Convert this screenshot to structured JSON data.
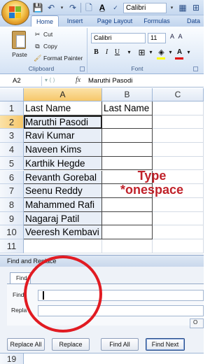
{
  "qat": {
    "font_value": "Calibri"
  },
  "tabs": [
    "Home",
    "Insert",
    "Page Layout",
    "Formulas",
    "Data"
  ],
  "clipboard": {
    "paste": "Paste",
    "cut": "Cut",
    "copy": "Copy",
    "format_painter": "Format Painter",
    "group_label": "Clipboard"
  },
  "font_group": {
    "font_name": "Calibri",
    "font_size": "11",
    "group_label": "Font",
    "bold": "B",
    "italic": "I",
    "underline": "U"
  },
  "formula_bar": {
    "name_box": "A2",
    "fx": "fx",
    "value": "Maruthi Pasodi"
  },
  "sheet": {
    "columns": [
      "A",
      "B",
      "C"
    ],
    "rows": [
      {
        "n": "1",
        "a": "Last Name",
        "b": "Last Name"
      },
      {
        "n": "2",
        "a": "Maruthi Pasodi",
        "b": ""
      },
      {
        "n": "3",
        "a": "Ravi Kumar",
        "b": ""
      },
      {
        "n": "4",
        "a": "Naveen Kims",
        "b": ""
      },
      {
        "n": "5",
        "a": "Karthik Hegde",
        "b": ""
      },
      {
        "n": "6",
        "a": "Revanth Gorebal",
        "b": ""
      },
      {
        "n": "7",
        "a": "Seenu Reddy",
        "b": ""
      },
      {
        "n": "8",
        "a": "Mahammed Rafi",
        "b": ""
      },
      {
        "n": "9",
        "a": "Nagaraj Patil",
        "b": ""
      },
      {
        "n": "10",
        "a": "Veeresh Kembavi",
        "b": ""
      },
      {
        "n": "11",
        "a": "",
        "b": ""
      }
    ],
    "bottom_row": "19"
  },
  "annotation": {
    "line1": "Type",
    "line2": "*onespace",
    "color": "#c0222a"
  },
  "dialog": {
    "title": "Find and Replace",
    "tab_find": "Find",
    "find_label": "Find",
    "replace_label": "Repla",
    "options_label": "O",
    "buttons": {
      "replace_all": "Replace All",
      "replace": "Replace",
      "find_all": "Find All",
      "find_next": "Find Next"
    }
  },
  "colors": {
    "highlight_ring": "#e11b22",
    "selected_header": "#f6c76a"
  }
}
